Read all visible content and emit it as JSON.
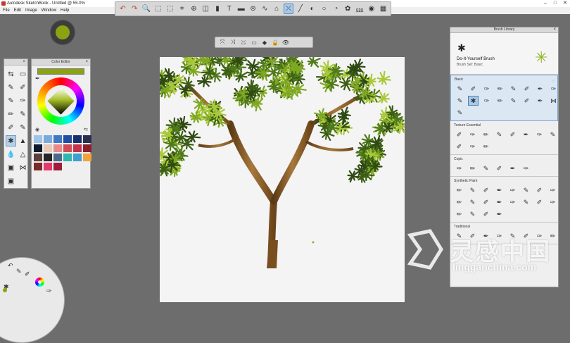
{
  "window": {
    "title": "Autodesk SketchBook - Untitled @ 55.0%",
    "controls": [
      "–",
      "□",
      "✕"
    ]
  },
  "menu": [
    "File",
    "Edit",
    "Image",
    "Window",
    "Help"
  ],
  "toolbar": {
    "tools": [
      {
        "name": "undo-icon",
        "glyph": "↶"
      },
      {
        "name": "redo-icon",
        "glyph": "↷"
      },
      {
        "name": "zoom-icon",
        "glyph": "🔍"
      },
      {
        "name": "select-icon",
        "glyph": "⬚"
      },
      {
        "name": "lasso-icon",
        "glyph": "⬚"
      },
      {
        "name": "crop-icon",
        "glyph": "⌗"
      },
      {
        "name": "transform-icon",
        "glyph": "⊕"
      },
      {
        "name": "symmetry-icon",
        "glyph": "◫"
      },
      {
        "name": "fill-icon",
        "glyph": "▮"
      },
      {
        "name": "text-icon",
        "glyph": "T"
      },
      {
        "name": "ruler-icon",
        "glyph": "▬"
      },
      {
        "name": "ellipse-icon",
        "glyph": "⊜"
      },
      {
        "name": "curve-icon",
        "glyph": "∿"
      },
      {
        "name": "copic-icon",
        "glyph": "⌂"
      },
      {
        "name": "active-tool-icon",
        "glyph": "⤫",
        "active": true
      },
      {
        "name": "line-icon",
        "glyph": "╱"
      },
      {
        "name": "stroke-icon",
        "glyph": "◐"
      },
      {
        "name": "circle-icon",
        "glyph": "○"
      },
      {
        "name": "brush-library-icon",
        "glyph": "◔"
      },
      {
        "name": "puck-icon",
        "glyph": "✿"
      },
      {
        "name": "brush-palette-icon",
        "glyph": "⅏"
      },
      {
        "name": "color-wheel-icon",
        "glyph": "◉"
      },
      {
        "name": "layers-icon",
        "glyph": "▦"
      }
    ]
  },
  "subtoolbar": {
    "tools": [
      "⤧",
      "⤨",
      "⤩",
      "▭",
      "◆",
      "🔒",
      "👁"
    ]
  },
  "color": {
    "current": "#8ba313"
  },
  "panels": {
    "color_editor": {
      "title": "Color Editor"
    },
    "brush_library": {
      "title": "Brush Library",
      "brush_name": "Do-It-Yourself Brush",
      "brush_set": "Brush Set: Basic",
      "sections": [
        {
          "title": "Basic",
          "count": 17
        },
        {
          "title": "Texture Essential",
          "count": 11
        },
        {
          "title": "Copic",
          "count": 6
        },
        {
          "title": "Synthetic Paint",
          "count": 20
        },
        {
          "title": "Traditional",
          "count": 8
        }
      ]
    }
  },
  "brush_palette": {
    "glyphs": [
      "⇆",
      "▭",
      "✎",
      "✐",
      "✎",
      "✑",
      "✏",
      "✎",
      "✐",
      "✎",
      "✱",
      "▲",
      "💧",
      "△",
      "▣",
      "⋈",
      "▣"
    ]
  },
  "swatches": [
    "#9ec4ea",
    "#7aa9dc",
    "#3e78c8",
    "#1f4ea2",
    "#172f6d",
    "#2b2f4c",
    "#0f1a2e",
    "#e7c9b8",
    "#e88a8a",
    "#d24d55",
    "#c5324a",
    "#8b1f2d",
    "#5a3f3a",
    "#262626",
    "#4a6a88",
    "#2fb6b0",
    "#3f9fd1",
    "#f0a43a",
    "#7b2a2a",
    "#e23a6a",
    "#a01c3b"
  ],
  "watermark": {
    "cn": "灵感中国",
    "url": "lingganchina.com"
  }
}
